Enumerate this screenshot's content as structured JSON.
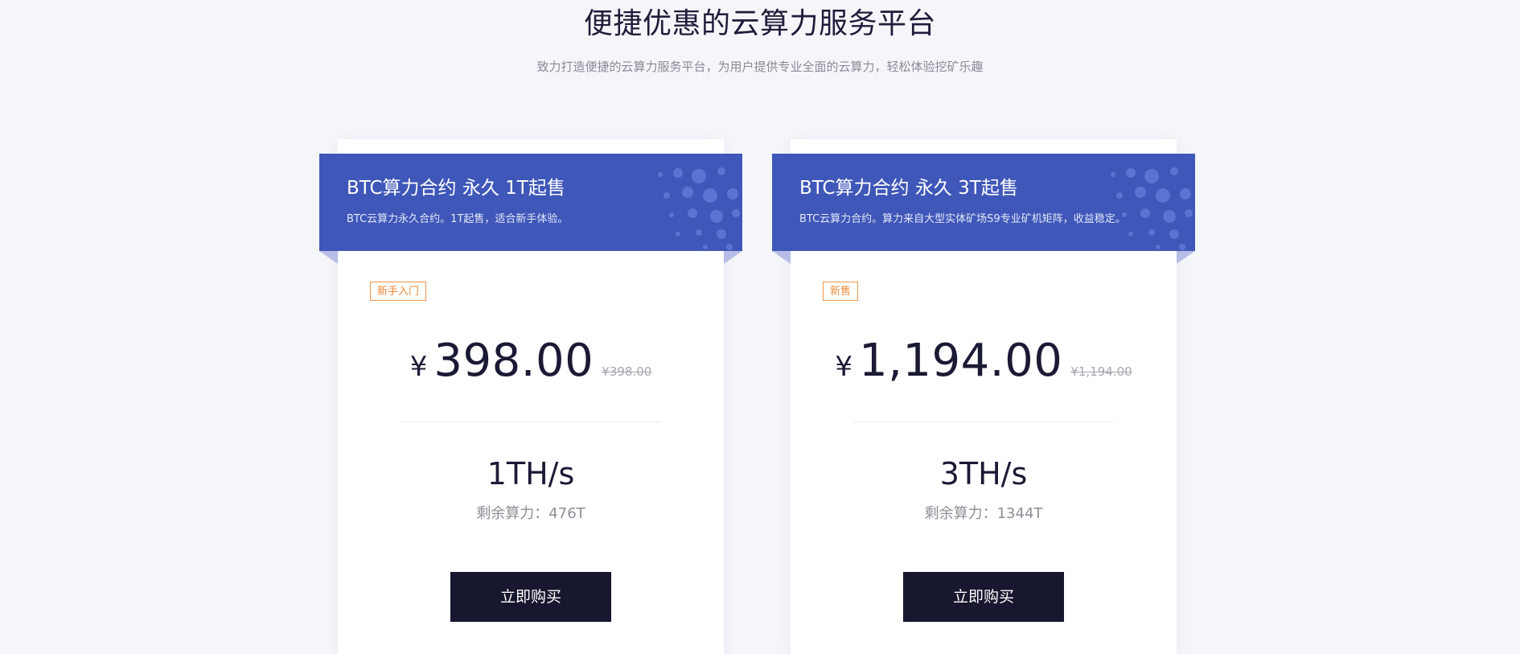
{
  "header": {
    "title": "便捷优惠的云算力服务平台",
    "subtitle": "致力打造便捷的云算力服务平台，为用户提供专业全面的云算力，轻松体验挖矿乐趣"
  },
  "colors": {
    "ribbon": "#3f57b8",
    "button": "#17172f",
    "tag": "#ef8a3a",
    "background": "#f5f6fa"
  },
  "products": [
    {
      "title": "BTC算力合约 永久 1T起售",
      "description": "BTC云算力永久合约。1T起售，适合新手体验。",
      "tag": "新手入门",
      "currency": "¥",
      "price": "398.00",
      "original_price": "¥398.00",
      "hashrate": "1TH/s",
      "remaining": "剩余算力：476T",
      "buy_label": "立即购买"
    },
    {
      "title": "BTC算力合约 永久 3T起售",
      "description": "BTC云算力合约。算力来自大型实体矿场S9专业矿机矩阵，收益稳定。",
      "tag": "新售",
      "currency": "¥",
      "price": "1,194.00",
      "original_price": "¥1,194.00",
      "hashrate": "3TH/s",
      "remaining": "剩余算力：1344T",
      "buy_label": "立即购买"
    }
  ]
}
